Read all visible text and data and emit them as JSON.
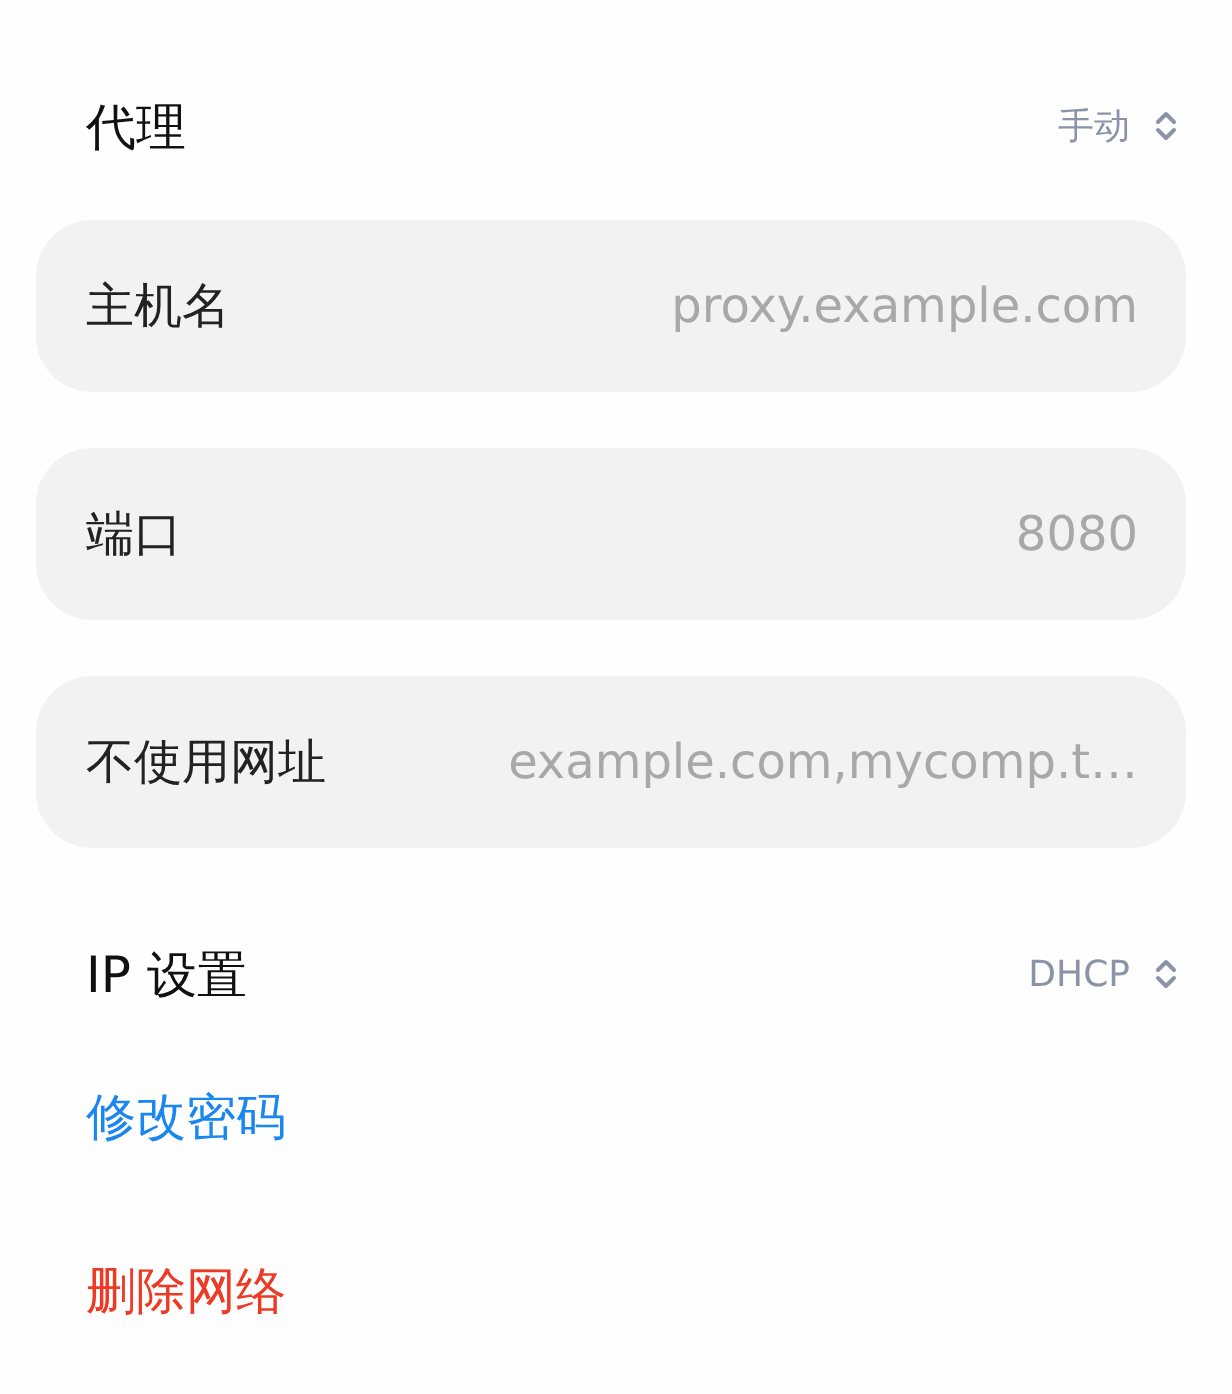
{
  "proxy": {
    "title": "代理",
    "mode": "手动"
  },
  "fields": [
    {
      "label": "主机名",
      "placeholder": "proxy.example.com"
    },
    {
      "label": "端口",
      "placeholder": "8080"
    },
    {
      "label": "不使用网址",
      "placeholder": "example.com,mycomp.t…"
    }
  ],
  "ip_settings": {
    "title": "IP 设置",
    "mode": "DHCP"
  },
  "actions": [
    {
      "kind": "link",
      "label": "修改密码"
    },
    {
      "kind": "danger",
      "label": "删除网络"
    }
  ]
}
